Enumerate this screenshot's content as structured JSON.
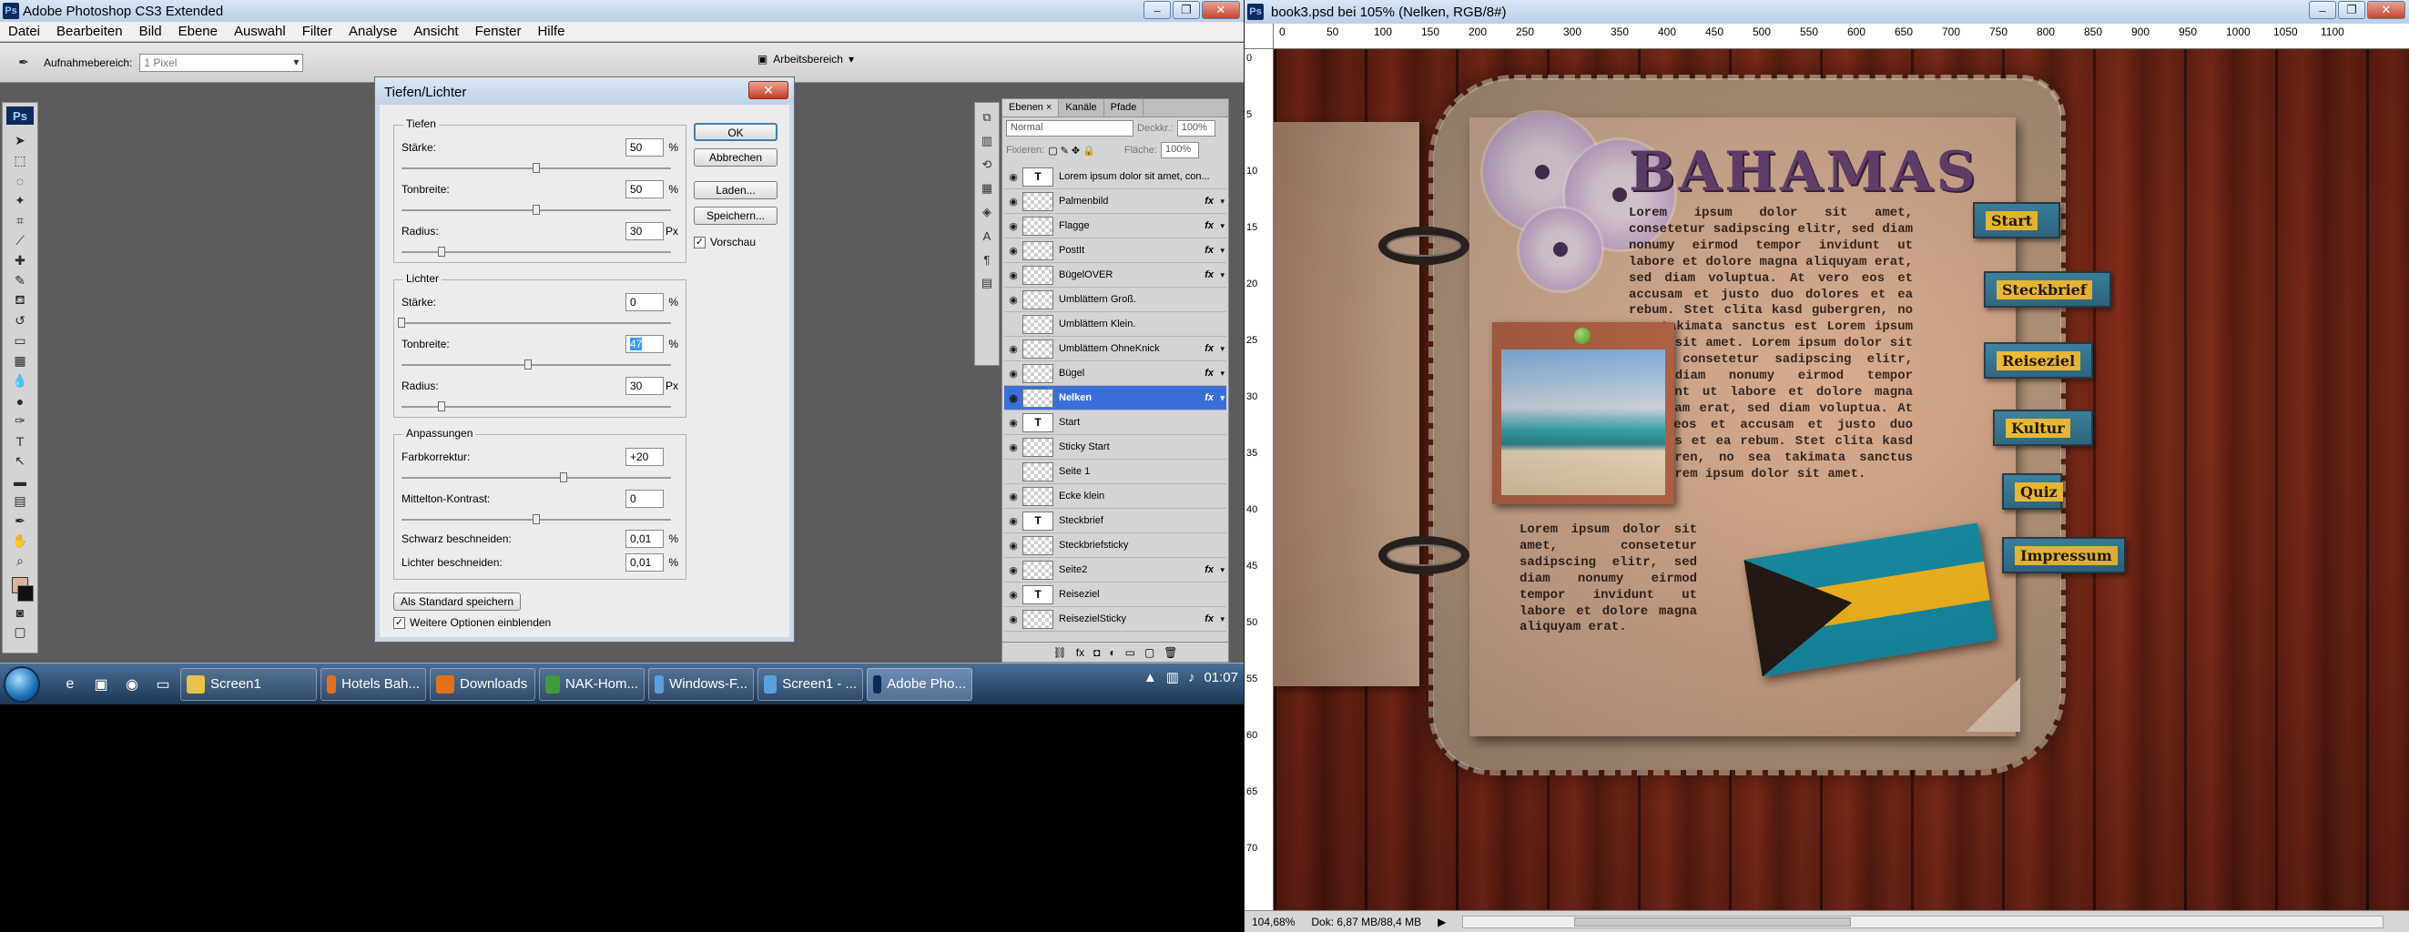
{
  "ps": {
    "title": "Adobe Photoshop CS3 Extended",
    "menu": [
      "Datei",
      "Bearbeiten",
      "Bild",
      "Ebene",
      "Auswahl",
      "Filter",
      "Analyse",
      "Ansicht",
      "Fenster",
      "Hilfe"
    ],
    "options": {
      "sample_label": "Aufnahmebereich:",
      "sample_value": "1 Pixel",
      "workspace": "Arbeitsbereich"
    },
    "toolbox_badge": "Ps"
  },
  "dialog": {
    "title": "Tiefen/Lichter",
    "tiefen": {
      "title": "Tiefen",
      "staerke": {
        "label": "Stärke:",
        "value": "50",
        "unit": "%",
        "level": 0.5
      },
      "tonbreite": {
        "label": "Tonbreite:",
        "value": "50",
        "unit": "%",
        "level": 0.5
      },
      "radius": {
        "label": "Radius:",
        "value": "30",
        "unit": "Px",
        "level": 0.15
      }
    },
    "lichter": {
      "title": "Lichter",
      "staerke": {
        "label": "Stärke:",
        "value": "0",
        "unit": "%",
        "level": 0.0
      },
      "tonbreite": {
        "label": "Tonbreite:",
        "value": "47",
        "unit": "%",
        "level": 0.47
      },
      "radius": {
        "label": "Radius:",
        "value": "30",
        "unit": "Px",
        "level": 0.15
      }
    },
    "anpassungen": {
      "title": "Anpassungen",
      "farbkorrektur": {
        "label": "Farbkorrektur:",
        "value": "+20",
        "level": 0.6
      },
      "mittelton": {
        "label": "Mittelton-Kontrast:",
        "value": "0",
        "level": 0.5
      },
      "schwarz": {
        "label": "Schwarz beschneiden:",
        "value": "0,01",
        "unit": "%"
      },
      "lichter_b": {
        "label": "Lichter beschneiden:",
        "value": "0,01",
        "unit": "%"
      }
    },
    "buttons": {
      "ok": "OK",
      "cancel": "Abbrechen",
      "load": "Laden...",
      "save": "Speichern...",
      "default": "Als Standard speichern"
    },
    "preview": {
      "label": "Vorschau",
      "checked": true
    },
    "more": {
      "label": "Weitere Optionen einblenden",
      "checked": true
    },
    "close": "✕"
  },
  "layers": {
    "tabs": [
      "Ebenen ×",
      "Kanäle",
      "Pfade"
    ],
    "blend_mode": "Normal",
    "opacity_label": "Deckkr.:",
    "opacity": "100%",
    "lock_label": "Fixieren:",
    "fill_label": "Fläche:",
    "fill": "100%",
    "items": [
      {
        "name": "Lorem ipsum dolor sit amet, con...",
        "visible": true,
        "kind": "text",
        "fx": false
      },
      {
        "name": "Palmenbild",
        "visible": true,
        "kind": "image",
        "fx": true
      },
      {
        "name": "Flagge",
        "visible": true,
        "kind": "image",
        "fx": true
      },
      {
        "name": "PostIt",
        "visible": true,
        "kind": "image",
        "fx": true
      },
      {
        "name": "BügelOVER",
        "visible": true,
        "kind": "image",
        "fx": true
      },
      {
        "name": "Umblättern Groß.",
        "visible": true,
        "kind": "image",
        "fx": false
      },
      {
        "name": "Umblättern Klein.",
        "visible": false,
        "kind": "image",
        "fx": false
      },
      {
        "name": "Umblättern OhneKnick",
        "visible": true,
        "kind": "image",
        "fx": true
      },
      {
        "name": "Bügel",
        "visible": true,
        "kind": "image",
        "fx": true
      },
      {
        "name": "Nelken",
        "visible": true,
        "kind": "image",
        "fx": true,
        "selected": true
      },
      {
        "name": "Start",
        "visible": true,
        "kind": "text",
        "fx": false
      },
      {
        "name": "Sticky Start",
        "visible": true,
        "kind": "image",
        "fx": false
      },
      {
        "name": "Seite 1",
        "visible": false,
        "kind": "image",
        "fx": false
      },
      {
        "name": "Ecke klein",
        "visible": true,
        "kind": "image",
        "fx": false
      },
      {
        "name": "Steckbrief",
        "visible": true,
        "kind": "text",
        "fx": false
      },
      {
        "name": "Steckbriefsticky",
        "visible": true,
        "kind": "image",
        "fx": false
      },
      {
        "name": "Seite2",
        "visible": true,
        "kind": "image",
        "fx": true
      },
      {
        "name": "Reiseziel",
        "visible": true,
        "kind": "text",
        "fx": false
      },
      {
        "name": "ReisezielSticky",
        "visible": true,
        "kind": "image",
        "fx": true
      }
    ]
  },
  "taskbar": {
    "tasks": [
      {
        "label": "Screen1",
        "icon": "folder-icon",
        "color": "#e8c34a"
      },
      {
        "label": "Hotels Bah...",
        "icon": "firefox-icon",
        "color": "#e2701c"
      },
      {
        "label": "Downloads",
        "icon": "firefox-icon",
        "color": "#e2701c"
      },
      {
        "label": "NAK-Hom...",
        "icon": "editor-icon",
        "color": "#3f9a3a"
      },
      {
        "label": "Windows-F...",
        "icon": "window-icon",
        "color": "#5aa0e0"
      },
      {
        "label": "Screen1 - ...",
        "icon": "window-icon",
        "color": "#5aa0e0"
      },
      {
        "label": "Adobe Pho...",
        "icon": "photoshop-icon",
        "color": "#0c2b5b"
      }
    ],
    "clock": "01:07"
  },
  "doc": {
    "title": "book3.psd bei 105% (Nelken, RGB/8#)",
    "ruler_h": [
      "0",
      "50",
      "100",
      "150",
      "200",
      "250",
      "300",
      "350",
      "400",
      "450",
      "500",
      "550",
      "600",
      "650",
      "700",
      "750",
      "800",
      "850",
      "900",
      "950",
      "1000",
      "1050",
      "1100"
    ],
    "ruler_v": [
      "0",
      "5",
      "10",
      "15",
      "20",
      "25",
      "30",
      "35",
      "40",
      "45",
      "50",
      "55",
      "60",
      "65",
      "70"
    ],
    "zoom": "104,68%",
    "doc_info": "Dok: 6,87 MB/88,4 MB",
    "brand": "BAHAMAS",
    "lorem_main": "Lorem ipsum dolor sit amet, consetetur sadipscing elitr, sed diam nonumy eirmod tempor invidunt ut labore et dolore magna aliquyam erat, sed diam voluptua. At vero eos et accusam et justo duo dolores et ea rebum. Stet clita kasd gubergren, no sea takimata sanctus est Lorem ipsum dolor sit amet. Lorem ipsum dolor sit amet, consetetur sadipscing elitr, sed diam nonumy eirmod tempor invidunt ut labore et dolore magna aliquyam erat, sed diam voluptua. At vero eos et accusam et justo duo dolores et ea rebum. Stet clita kasd gubergren, no sea takimata sanctus est Lorem ipsum dolor sit amet.",
    "lorem_small": "Lorem ipsum dolor sit amet, consetetur sadipscing elitr, sed diam nonumy eirmod tempor invidunt ut labore et dolore magna aliquyam erat.",
    "nav": [
      "Start",
      "Steckbrief",
      "Reiseziel",
      "Kultur",
      "Quiz",
      "Impressum"
    ]
  }
}
